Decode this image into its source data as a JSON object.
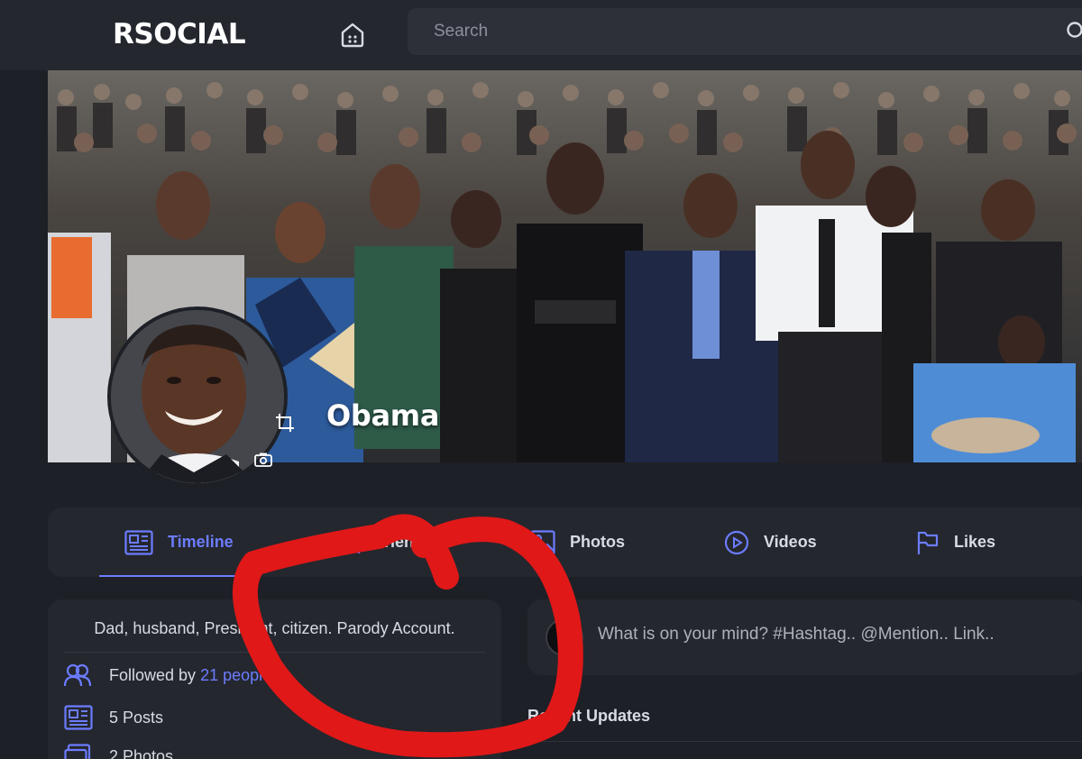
{
  "brand": {
    "logo_text": "RSOCIAL"
  },
  "header": {
    "home_icon": "home-icon",
    "search_placeholder": "Search",
    "search_icon": "search-icon"
  },
  "profile": {
    "name": "Obama",
    "bio": "Dad, husband, President, citizen. Parody Account.",
    "followed_prefix": "Followed by ",
    "followed_link": "21 people",
    "posts": "5 Posts",
    "photos": "2 Photos"
  },
  "tabs": [
    {
      "label": "Timeline",
      "icon": "newspaper-icon",
      "active": true
    },
    {
      "label": "Friends",
      "icon": "users-icon",
      "active": false
    },
    {
      "label": "Photos",
      "icon": "image-icon",
      "active": false
    },
    {
      "label": "Videos",
      "icon": "play-icon",
      "active": false
    },
    {
      "label": "Likes",
      "icon": "flag-icon",
      "active": false
    }
  ],
  "composer": {
    "placeholder": "What is on your mind? #Hashtag.. @Mention.. Link.."
  },
  "feed": {
    "section_title": "Recent Updates"
  },
  "colors": {
    "accent": "#6c7cff",
    "background": "#1d2026",
    "card": "#24272e",
    "annotation": "#e01818"
  }
}
